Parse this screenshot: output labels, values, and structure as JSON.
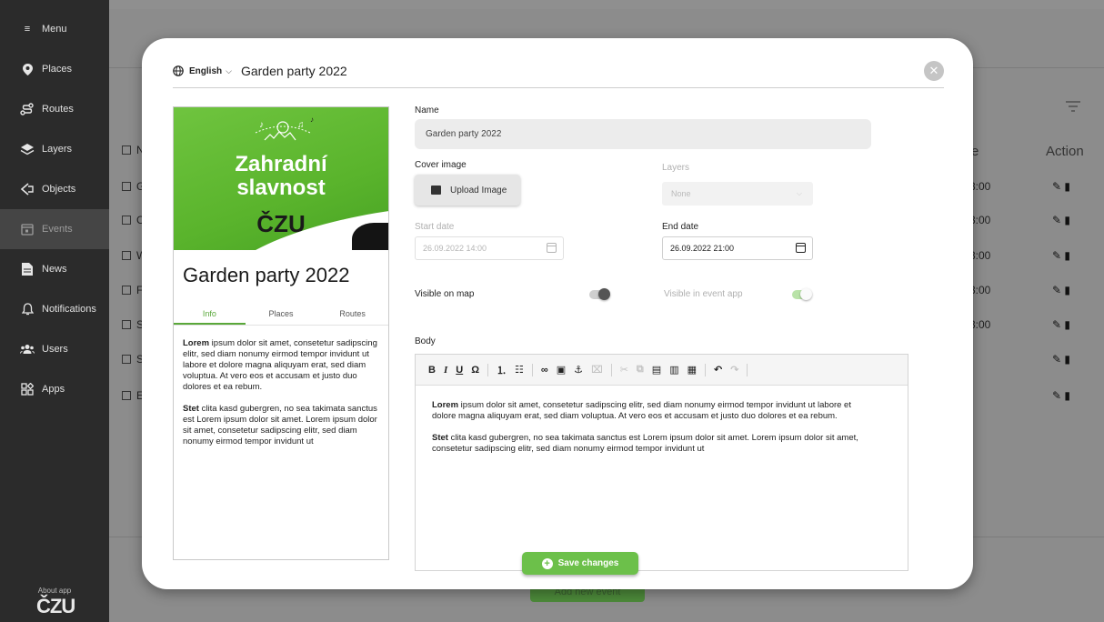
{
  "sidebar": {
    "items": [
      {
        "label": "Menu",
        "icon": "hamburger-icon"
      },
      {
        "label": "Places",
        "icon": "pin-icon"
      },
      {
        "label": "Routes",
        "icon": "route-icon"
      },
      {
        "label": "Layers",
        "icon": "layers-icon"
      },
      {
        "label": "Objects",
        "icon": "objects-icon"
      },
      {
        "label": "Events",
        "icon": "calendar-icon"
      },
      {
        "label": "News",
        "icon": "document-icon"
      },
      {
        "label": "Notifications",
        "icon": "bell-icon"
      },
      {
        "label": "Users",
        "icon": "users-icon"
      },
      {
        "label": "Apps",
        "icon": "apps-icon"
      }
    ],
    "about": "About app",
    "logo": "ČZU"
  },
  "background": {
    "col_time_fragment": "e",
    "col_action": "Action",
    "row_letters": [
      "N",
      "G",
      "C",
      "W",
      "F",
      "S",
      "S",
      "E"
    ],
    "times": [
      "3:00",
      "3:00",
      "3:00",
      "3:00",
      "3:00"
    ],
    "add_button": "Add new event"
  },
  "modal": {
    "language": "English",
    "title": "Garden party 2022",
    "preview": {
      "cover_title_line1": "Zahradní",
      "cover_title_line2": "slavnost",
      "cover_sub": "ČZU",
      "title": "Garden party 2022",
      "tabs": [
        "Info",
        "Places",
        "Routes"
      ],
      "p1_bold": "Lorem",
      "p1_rest": " ipsum dolor sit amet, consetetur sadipscing elitr, sed diam nonumy eirmod tempor invidunt ut labore et dolore magna aliquyam erat, sed diam voluptua. At vero eos et accusam et justo duo dolores et ea rebum.",
      "p2_bold": "Stet",
      "p2_rest": " clita kasd gubergren, no sea takimata sanctus est Lorem ipsum dolor sit amet. Lorem ipsum dolor sit amet, consetetur sadipscing elitr, sed diam nonumy eirmod tempor invidunt ut"
    },
    "form": {
      "name_label": "Name",
      "name_value": "Garden party 2022",
      "cover_label": "Cover image",
      "upload_label": "Upload Image",
      "layers_label": "Layers",
      "layers_value": "None",
      "start_label": "Start date",
      "start_value": "26.09.2022 14:00",
      "end_label": "End date",
      "end_value": "26.09.2022 21:00",
      "visible_map_label": "Visible on map",
      "visible_map_on": false,
      "visible_app_label": "Visible in event app",
      "visible_app_on": true,
      "body_label": "Body"
    },
    "editor": {
      "p1_bold": "Lorem",
      "p1_rest": " ipsum dolor sit amet, consetetur sadipscing elitr, sed diam nonumy eirmod tempor invidunt ut labore et dolore magna aliquyam erat, sed diam voluptua. At vero eos et accusam et justo duo dolores et ea rebum.",
      "p2_bold": "Stet",
      "p2_rest": " clita kasd gubergren, no sea takimata sanctus est Lorem ipsum dolor sit amet. Lorem ipsum dolor sit amet, consetetur sadipscing elitr, sed diam nonumy eirmod tempor invidunt ut"
    },
    "save_label": "Save changes"
  },
  "colors": {
    "accent": "#6cc04a",
    "sidebar_bg": "#2b2b2b"
  }
}
